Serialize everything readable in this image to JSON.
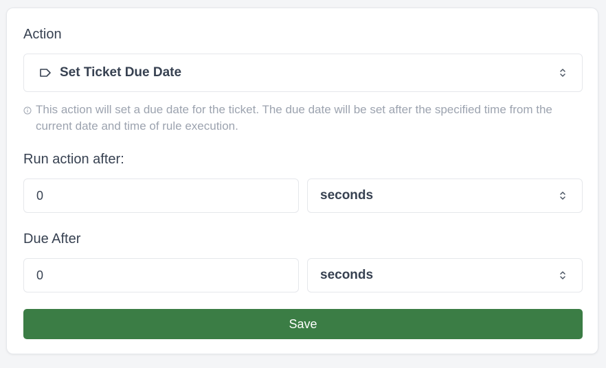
{
  "action": {
    "label": "Action",
    "selected": "Set Ticket Due Date",
    "icon": "tag-icon",
    "hint": "This action will set a due date for the ticket. The due date will be set after the specified time from the current date and time of rule execution."
  },
  "run_after": {
    "label": "Run action after:",
    "value": "0",
    "unit": "seconds"
  },
  "due_after": {
    "label": "Due After",
    "value": "0",
    "unit": "seconds"
  },
  "save_label": "Save",
  "colors": {
    "primary": "#3b7d45",
    "text": "#374151",
    "muted": "#9ca3af",
    "border": "#e5e7eb"
  }
}
